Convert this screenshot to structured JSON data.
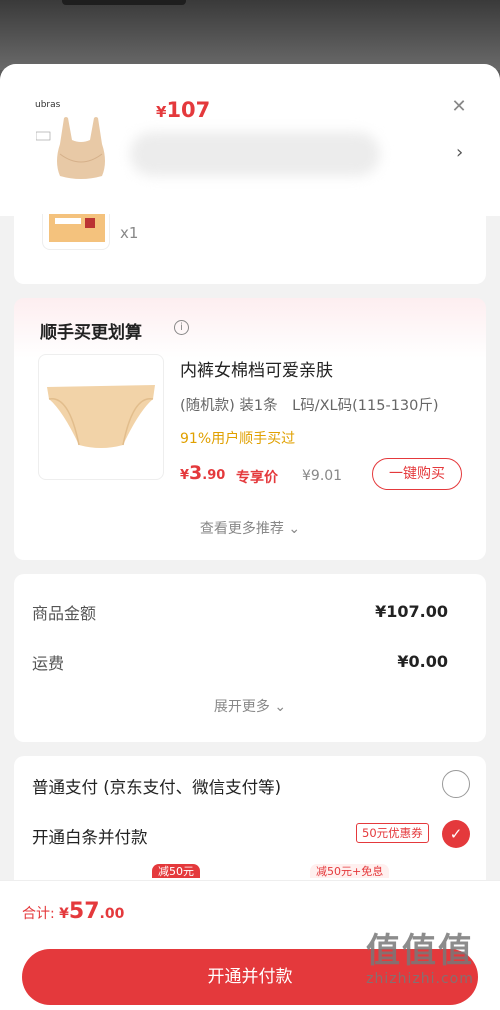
{
  "header": {
    "brand": "ubras",
    "price_symbol": "¥",
    "price": "107",
    "close_icon": "close-icon",
    "more_icon": "chevron-right-icon"
  },
  "item_summary": {
    "quantity": "x1"
  },
  "recommend": {
    "title": "顺手买更划算",
    "info_icon": "info-icon",
    "product": {
      "name": "内裤女棉档可爱亲肤",
      "spec": "(随机款) 装1条　L码/XL码(115-130斤)",
      "social": "91%用户顺手买过",
      "price_symbol": "¥",
      "price_int": "3",
      "price_dec": ".90",
      "exclusive_label": "专享价",
      "original_price": "¥9.01",
      "buy_label": "一键购买"
    },
    "more_label": "查看更多推荐"
  },
  "summary": {
    "rows": [
      {
        "label": "商品金额",
        "value": "¥107.00"
      },
      {
        "label": "运费",
        "value": "¥0.00"
      }
    ],
    "expand_label": "展开更多"
  },
  "payment": {
    "options": [
      {
        "label": "普通支付 (京东支付、微信支付等)",
        "selected": false
      },
      {
        "label": "开通白条并付款",
        "selected": true
      }
    ],
    "coupon": "50元优惠券",
    "chips": [
      "减50元",
      "减50元+免息"
    ]
  },
  "footer": {
    "total_label": "合计: ",
    "symbol": "¥",
    "total_int": "57",
    "total_dec": ".00",
    "cta_label": "开通并付款"
  },
  "watermark": {
    "logo": "值值值",
    "site": "zhizhizhi.com"
  },
  "colors": {
    "accent": "#e4393c",
    "social": "#e0a000"
  }
}
